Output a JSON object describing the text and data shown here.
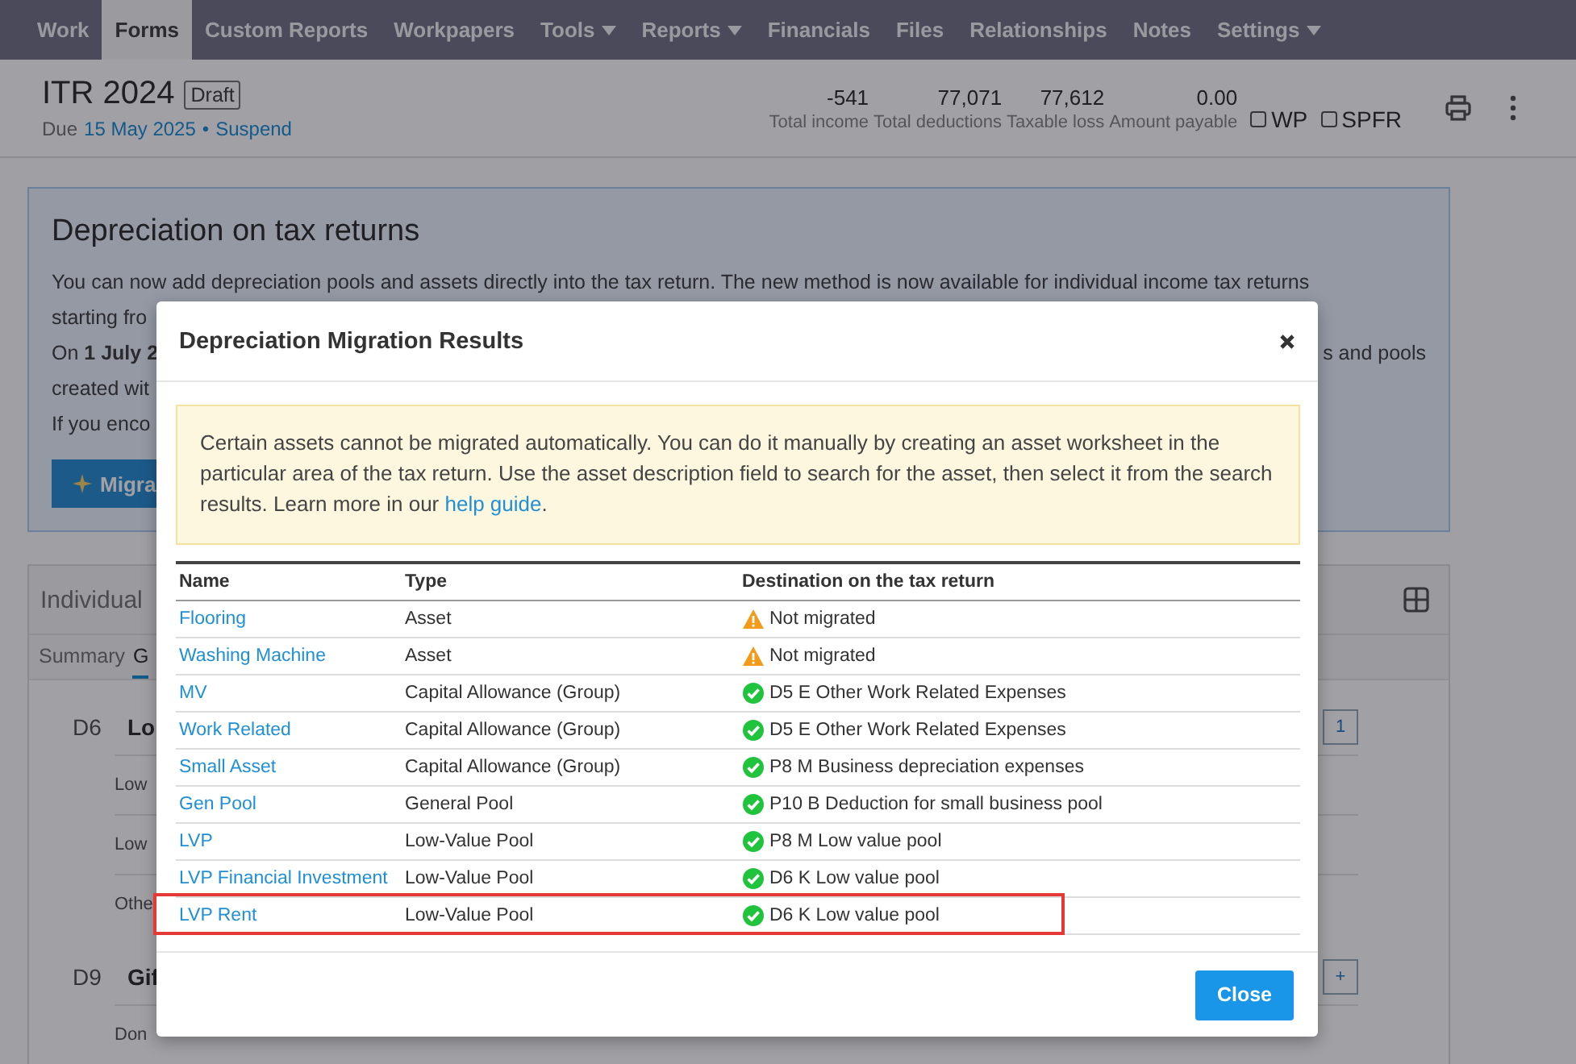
{
  "nav": {
    "items": [
      {
        "label": "Work",
        "selected": false,
        "dropdown": false
      },
      {
        "label": "Forms",
        "selected": true,
        "dropdown": false
      },
      {
        "label": "Custom Reports",
        "selected": false,
        "dropdown": false
      },
      {
        "label": "Workpapers",
        "selected": false,
        "dropdown": false
      },
      {
        "label": "Tools",
        "selected": false,
        "dropdown": true
      },
      {
        "label": "Reports",
        "selected": false,
        "dropdown": true
      },
      {
        "label": "Financials",
        "selected": false,
        "dropdown": false
      },
      {
        "label": "Files",
        "selected": false,
        "dropdown": false
      },
      {
        "label": "Relationships",
        "selected": false,
        "dropdown": false
      },
      {
        "label": "Notes",
        "selected": false,
        "dropdown": false
      },
      {
        "label": "Settings",
        "selected": false,
        "dropdown": true
      }
    ]
  },
  "header": {
    "title": "ITR 2024",
    "badge": "Draft",
    "due_prefix": "Due",
    "due_date": "15 May 2025",
    "separator": "•",
    "action": "Suspend",
    "summary": [
      {
        "value": "-541",
        "label": "Total income"
      },
      {
        "value": "77,071",
        "label": "Total deductions"
      },
      {
        "value": "77,612",
        "label": "Taxable loss"
      },
      {
        "value": "0.00",
        "label": "Amount payable"
      }
    ],
    "checkboxes": [
      {
        "label": "WP",
        "checked": false
      },
      {
        "label": "SPFR",
        "checked": false
      }
    ]
  },
  "notice": {
    "title": "Depreciation on tax returns",
    "line_1": "You can now add depreciation pools and assets directly into the tax return. The new method is now available for individual income tax returns",
    "line_2": "starting fro",
    "line_3": "On **1 July 2**",
    "line_3_end": "s and pools",
    "line_4": "created wit",
    "line_5": "If you enco",
    "button": "Migra"
  },
  "section": {
    "title": "Individual",
    "tabs": [
      {
        "label": "Summary",
        "selected": false
      },
      {
        "label": "G",
        "selected": true
      }
    ],
    "groups": [
      {
        "code": "D6",
        "title": "Lo",
        "count": "1",
        "rows": [
          "Low",
          "Low",
          "Othe"
        ]
      },
      {
        "code": "D9",
        "title": "Gif",
        "count": "+",
        "rows": [
          "Don"
        ]
      }
    ]
  },
  "modal": {
    "title": "Depreciation Migration Results",
    "alert": {
      "text": "Certain assets cannot be migrated automatically. You can do it manually by creating an asset worksheet in the particular area of the tax return. Use the asset description field to search for the asset, then select it from the search results. Learn more in our ",
      "link": "help guide",
      "end": "."
    },
    "columns": [
      "Name",
      "Type",
      "Destination on the tax return"
    ],
    "rows": [
      {
        "name": "Flooring",
        "type": "Asset",
        "destination": "Not migrated",
        "kind": "warning",
        "highlighted": false
      },
      {
        "name": "Washing Machine",
        "type": "Asset",
        "destination": "Not migrated",
        "kind": "warning",
        "highlighted": false
      },
      {
        "name": "MV",
        "type": "Capital Allowance (Group)",
        "destination": "D5 E Other Work Related Expenses",
        "kind": "ok",
        "highlighted": false
      },
      {
        "name": "Work Related",
        "type": "Capital Allowance (Group)",
        "destination": "D5 E Other Work Related Expenses",
        "kind": "ok",
        "highlighted": false
      },
      {
        "name": "Small Asset",
        "type": "Capital Allowance (Group)",
        "destination": "P8 M Business depreciation expenses",
        "kind": "ok",
        "highlighted": false
      },
      {
        "name": "Gen Pool",
        "type": "General Pool",
        "destination": "P10 B Deduction for small business pool",
        "kind": "ok",
        "highlighted": false
      },
      {
        "name": "LVP",
        "type": "Low-Value Pool",
        "destination": "P8 M Low value pool",
        "kind": "ok",
        "highlighted": false
      },
      {
        "name": "LVP Financial Investment",
        "type": "Low-Value Pool",
        "destination": "D6 K Low value pool",
        "kind": "ok",
        "highlighted": false
      },
      {
        "name": "LVP Rent",
        "type": "Low-Value Pool",
        "destination": "D6 K Low value pool",
        "kind": "ok",
        "highlighted": true
      }
    ],
    "close": "Close"
  }
}
